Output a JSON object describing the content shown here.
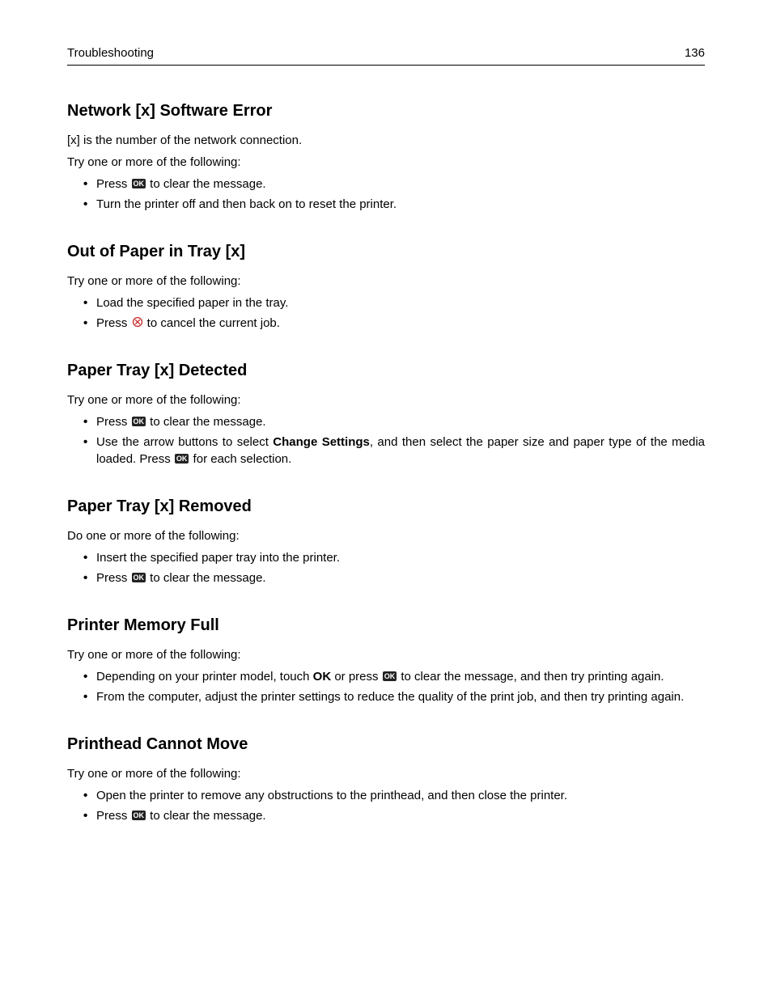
{
  "header": {
    "section": "Troubleshooting",
    "page": "136"
  },
  "sections": [
    {
      "title": "Network [x] Software Error",
      "intro": "[x] is the number of the network connection.",
      "lead": "Try one or more of the following:",
      "items": [
        {
          "pre": "Press ",
          "icon": "ok",
          "post": " to clear the message."
        },
        {
          "pre": "Turn the printer off and then back on to reset the printer."
        }
      ]
    },
    {
      "title": "Out of Paper in Tray [x]",
      "lead": "Try one or more of the following:",
      "items": [
        {
          "pre": "Load the specified paper in the tray."
        },
        {
          "pre": "Press ",
          "icon": "cancel",
          "post": " to cancel the current job."
        }
      ]
    },
    {
      "title": "Paper Tray [x] Detected",
      "lead": "Try one or more of the following:",
      "items": [
        {
          "pre": "Press ",
          "icon": "ok",
          "post": " to clear the message."
        },
        {
          "pre": "Use the arrow buttons to select ",
          "bold": "Change Settings",
          "post": ", and then select the paper size and paper type of the media loaded. Press ",
          "icon": "ok",
          "post2": " for each selection.",
          "justify": true
        }
      ]
    },
    {
      "title": "Paper Tray [x] Removed",
      "lead": "Do one or more of the following:",
      "items": [
        {
          "pre": "Insert the specified paper tray into the printer."
        },
        {
          "pre": "Press ",
          "icon": "ok",
          "post": " to clear the message."
        }
      ]
    },
    {
      "title": "Printer Memory Full",
      "lead": "Try one or more of the following:",
      "items": [
        {
          "pre": "Depending on your printer model, touch ",
          "bold": "OK",
          "mid": " or press ",
          "icon": "ok",
          "post": " to clear the message, and then try printing again."
        },
        {
          "pre": "From the computer, adjust the printer settings to reduce the quality of the print job, and then try printing again."
        }
      ]
    },
    {
      "title": "Printhead Cannot Move",
      "lead": "Try one or more of the following:",
      "items": [
        {
          "pre": "Open the printer to remove any obstructions to the printhead, and then close the printer."
        },
        {
          "pre": "Press ",
          "icon": "ok",
          "post": " to clear the message."
        }
      ]
    }
  ],
  "icons": {
    "ok_label": "OK"
  }
}
